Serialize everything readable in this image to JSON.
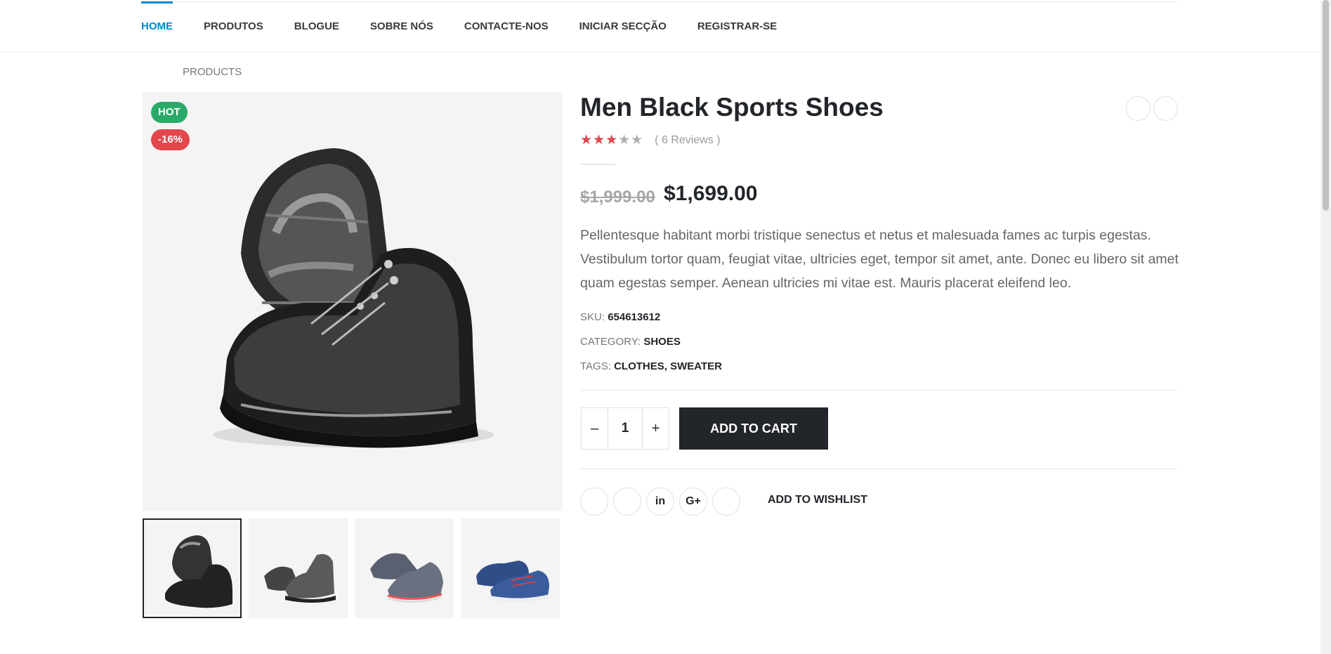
{
  "nav": {
    "items": [
      {
        "label": "HOME",
        "active": true
      },
      {
        "label": "PRODUTOS",
        "active": false
      },
      {
        "label": "BLOGUE",
        "active": false
      },
      {
        "label": "SOBRE NÓS",
        "active": false
      },
      {
        "label": "CONTACTE-NOS",
        "active": false
      },
      {
        "label": "INICIAR SECÇÃO",
        "active": false
      },
      {
        "label": "REGISTRAR-SE",
        "active": false
      }
    ]
  },
  "breadcrumb": "PRODUCTS",
  "product": {
    "badges": {
      "hot": "HOT",
      "sale": "-16%"
    },
    "title": "Men Black Sports Shoes",
    "rating": 3,
    "rating_max": 5,
    "reviews": "( 6 Reviews )",
    "old_price": "$1,999.00",
    "new_price": "$1,699.00",
    "description": "Pellentesque habitant morbi tristique senectus et netus et malesuada fames ac turpis egestas. Vestibulum tortor quam, feugiat vitae, ultricies eget, tempor sit amet, ante. Donec eu libero sit amet quam egestas semper. Aenean ultricies mi vitae est. Mauris placerat eleifend leo.",
    "sku_label": "SKU:",
    "sku": "654613612",
    "category_label": "CATEGORY:",
    "category": "SHOES",
    "tags_label": "TAGS:",
    "tags": [
      "CLOTHES",
      "SWEATER"
    ],
    "quantity": "1",
    "add_to_cart": "ADD TO CART",
    "add_to_wishlist": "ADD TO WISHLIST",
    "thumbnails": [
      "black-boots-pair",
      "grey-boot-pair",
      "grey-sneakers",
      "blue-shoes"
    ]
  },
  "qty_controls": {
    "minus": "–",
    "plus": "+"
  },
  "share": [
    "facebook-icon",
    "twitter-icon",
    "linkedin-icon",
    "google-plus-icon",
    "email-icon"
  ],
  "share_labels": {
    "linkedin": "in",
    "google": "G+"
  },
  "colors": {
    "accent": "#0188cc",
    "hot": "#2ba968",
    "sale": "#e2474b",
    "dark": "#222529"
  }
}
